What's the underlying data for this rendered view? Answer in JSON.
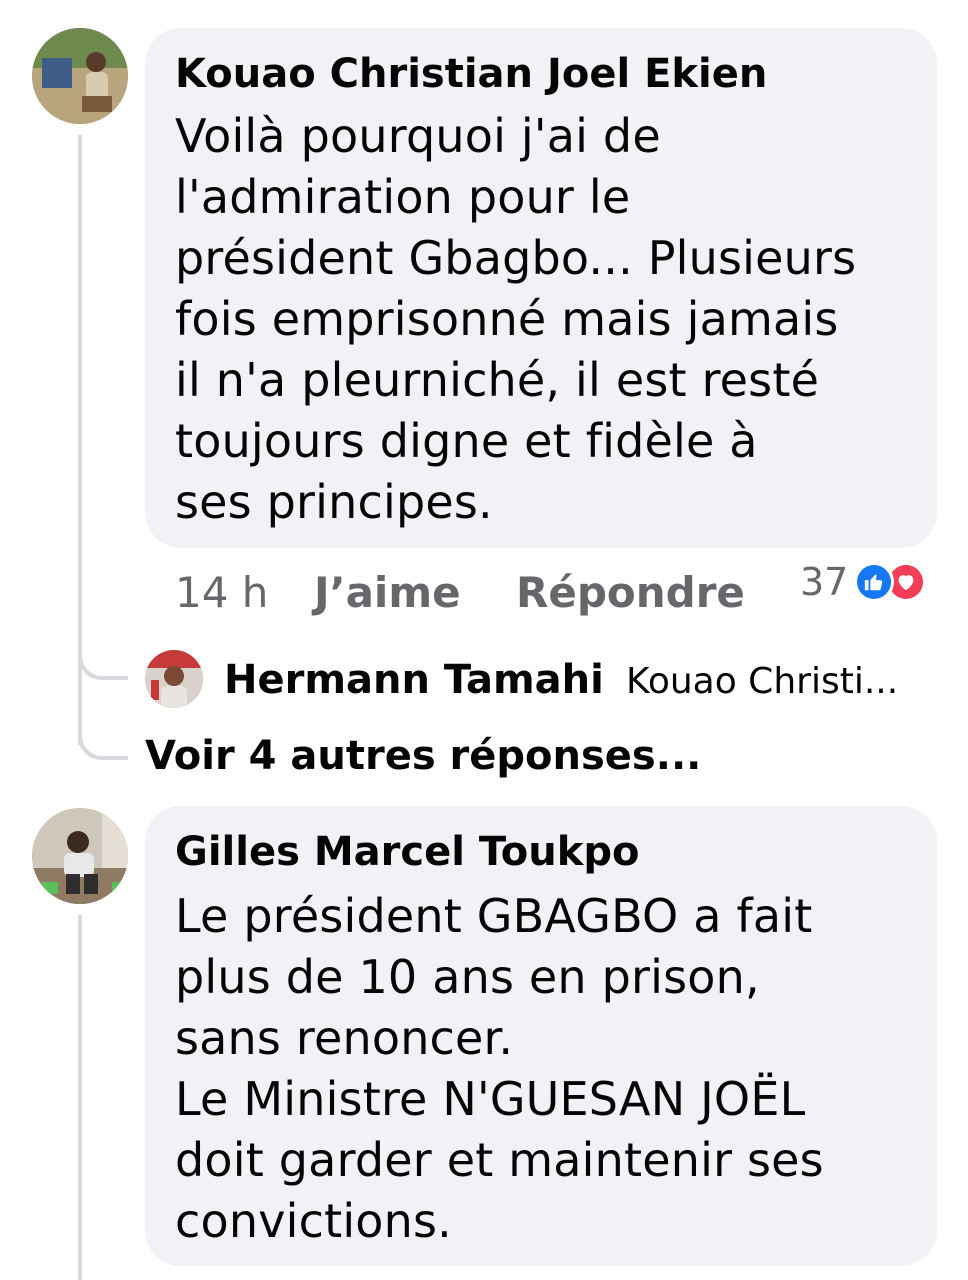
{
  "comments": [
    {
      "author": "Kouao Christian Joel Ekien",
      "text": "Voilà pourquoi j'ai de\nl'admiration pour le\nprésident Gbagbo... Plusieurs\nfois emprisonné mais jamais\nil n'a pleurniché, il est resté\ntoujours digne et fidèle à\nses principes.",
      "time": "14 h",
      "like_label": "J’aime",
      "reply_label": "Répondre",
      "reaction_count": "37",
      "reactions": [
        "like-icon",
        "love-icon"
      ],
      "reply_preview": {
        "author": "Hermann Tamahi",
        "snippet": "Kouao Christi..."
      },
      "more_replies": "Voir 4 autres réponses..."
    },
    {
      "author": "Gilles Marcel Toukpo",
      "text": "Le président GBAGBO a fait\nplus de 10 ans en prison,\nsans renoncer.\nLe Ministre N'GUESAN JOËL\ndoit garder et maintenir ses\nconvictions."
    }
  ],
  "colors": {
    "bubble": "#f0f2f5",
    "meta_text": "#65676b",
    "like": "#1877f2",
    "love": "#f33e58",
    "thread_line": "#d6d9dd"
  }
}
